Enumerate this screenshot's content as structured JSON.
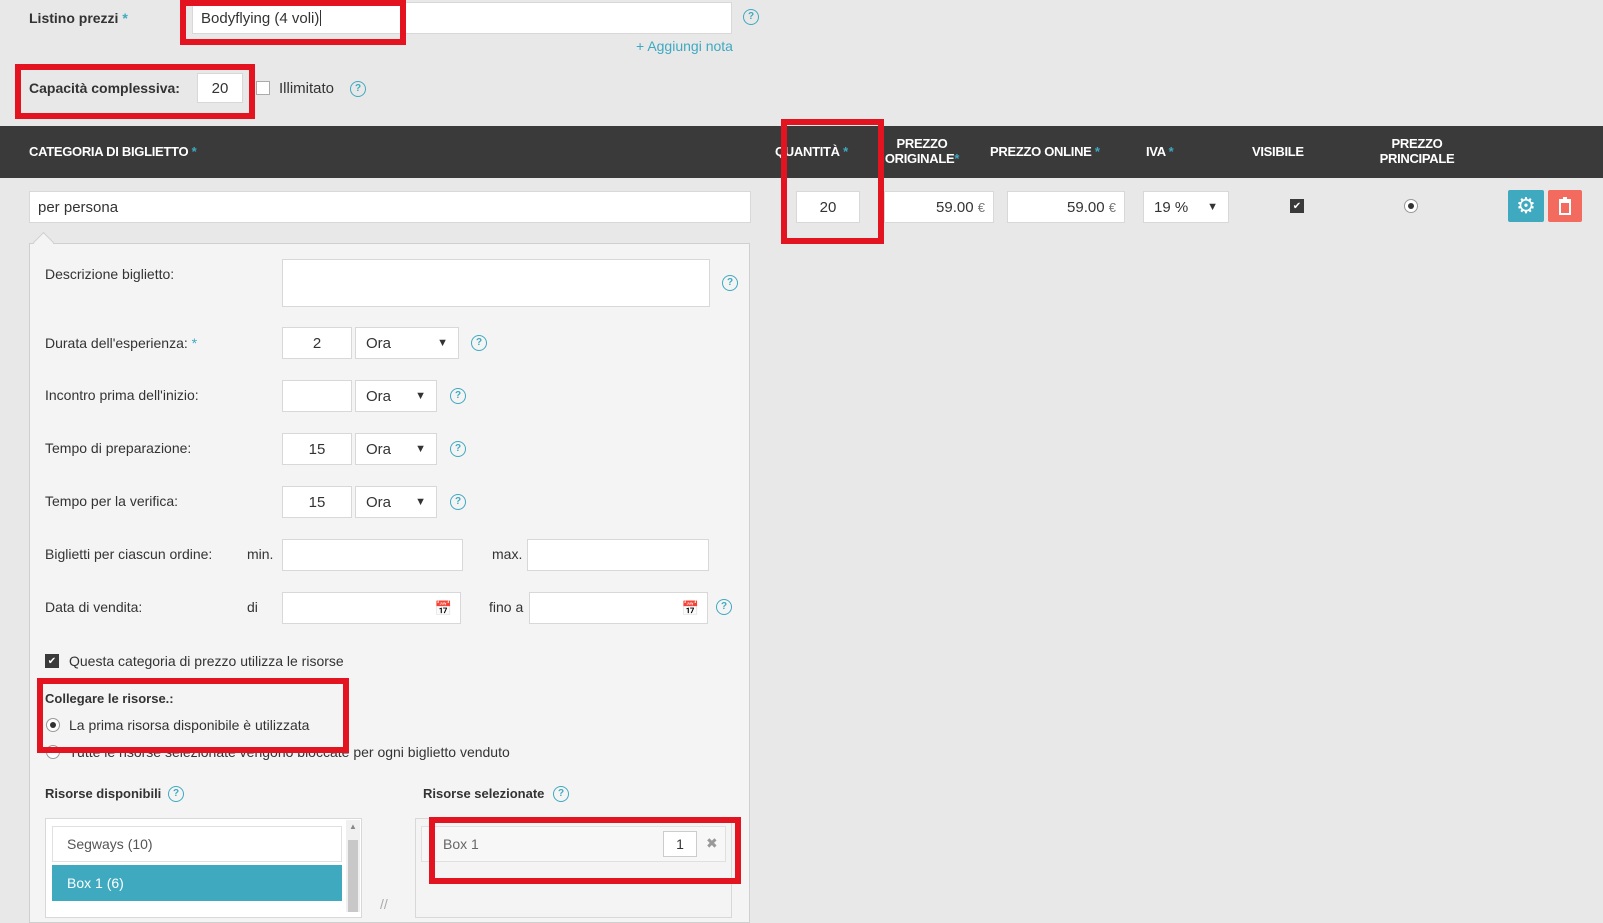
{
  "pricelist": {
    "label": "Listino prezzi",
    "required": "*",
    "value": "Bodyflying (4 voli)",
    "add_note": "Aggiungi nota",
    "add_note_plus": "+"
  },
  "capacity": {
    "label": "Capacità complessiva:",
    "value": "20",
    "unlimited_label": "Illimitato"
  },
  "table": {
    "headers": {
      "category": "CATEGORIA DI BIGLIETTO",
      "quantity": "QUANTITÀ",
      "original_price_1": "PREZZO",
      "original_price_2": "ORIGINALE",
      "online_price": "PREZZO ONLINE",
      "vat": "IVA",
      "visible": "VISIBILE",
      "main_price_1": "PREZZO",
      "main_price_2": "PRINCIPALE"
    },
    "row": {
      "category": "per persona",
      "quantity": "20",
      "original_price": "59.00",
      "online_price": "59.00",
      "currency": "€",
      "vat": "19 %"
    }
  },
  "details": {
    "description_label": "Descrizione biglietto:",
    "duration_label": "Durata dell'esperienza:",
    "duration_value": "2",
    "duration_unit": "Ora",
    "meeting_label": "Incontro prima dell'inizio:",
    "meeting_value": "",
    "meeting_unit": "Ora",
    "prep_label": "Tempo di preparazione:",
    "prep_value": "15",
    "prep_unit": "Ora",
    "check_label": "Tempo per la verifica:",
    "check_value": "15",
    "check_unit": "Ora",
    "tickets_label": "Biglietti per ciascun ordine:",
    "min_label": "min.",
    "max_label": "max.",
    "sale_label": "Data di vendita:",
    "from_label": "di",
    "to_label": "fino a",
    "uses_resources_label": "Questa categoria di prezzo utilizza le risorse",
    "link_resources_label": "Collegare le risorse.:",
    "option_first": "La prima risorsa disponibile è utilizzata",
    "option_all": "Tutte le risorse selezionate vengono bloccate per ogni biglietto venduto",
    "available_label": "Risorse disponibili",
    "selected_label": "Risorse selezionate",
    "available": [
      "Segways (10)",
      "Box 1 (6)"
    ],
    "selected": [
      {
        "name": "Box 1",
        "qty": "1"
      }
    ]
  }
}
